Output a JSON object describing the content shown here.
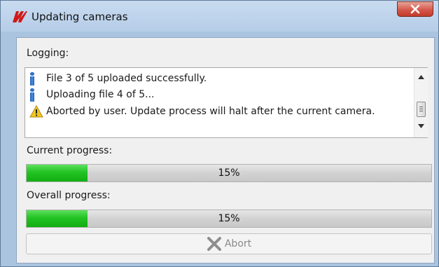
{
  "window": {
    "title": "Updating cameras",
    "app_logo": "brand-logo-icon",
    "close_icon": "close-x-icon",
    "close_color": "#c9483a"
  },
  "logging": {
    "label": "Logging:",
    "entries": [
      {
        "icon": "info-icon",
        "text": "File 3 of 5 uploaded successfully."
      },
      {
        "icon": "info-icon",
        "text": "Uploading file 4 of 5..."
      },
      {
        "icon": "warning-icon",
        "text": "Aborted by user. Update process will halt after the current camera."
      }
    ]
  },
  "current_progress": {
    "label": "Current progress:",
    "value": 0.15,
    "text": "15%",
    "fill_color": "#22c322"
  },
  "overall_progress": {
    "label": "Overall progress:",
    "value": 0.15,
    "text": "15%",
    "fill_color": "#22c322"
  },
  "abort_button": {
    "label": "Abort",
    "icon": "abort-x-icon",
    "state": "disabled"
  }
}
